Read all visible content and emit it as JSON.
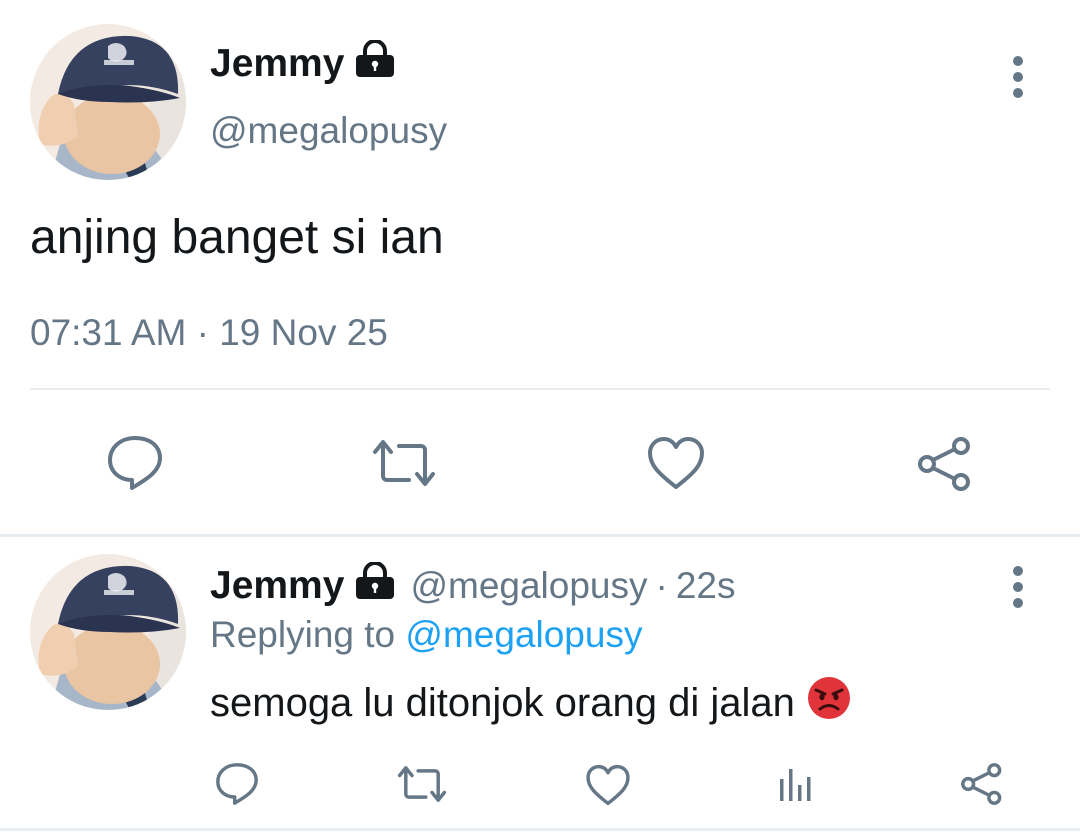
{
  "main_tweet": {
    "display_name": "Jemmy",
    "handle": "@megalopusy",
    "protected_icon": "lock-icon",
    "text": "anjing banget si ian",
    "timestamp": "07:31 AM · 19 Nov 25",
    "actions": [
      "reply-icon",
      "retweet-icon",
      "like-icon",
      "share-icon"
    ]
  },
  "reply_tweet": {
    "display_name": "Jemmy",
    "handle": "@megalopusy",
    "separator": "·",
    "age": "22s",
    "replying_prefix": "Replying to",
    "replying_handle": "@megalopusy",
    "text": "semoga lu ditonjok orang di jalan",
    "emoji": "pouting-face-emoji",
    "actions": [
      "reply-icon",
      "retweet-icon",
      "like-icon",
      "analytics-icon",
      "share-icon"
    ]
  },
  "colors": {
    "text": "#14171a",
    "secondary": "#657786",
    "link": "#1da1f2",
    "divider": "#e6ecf0"
  }
}
